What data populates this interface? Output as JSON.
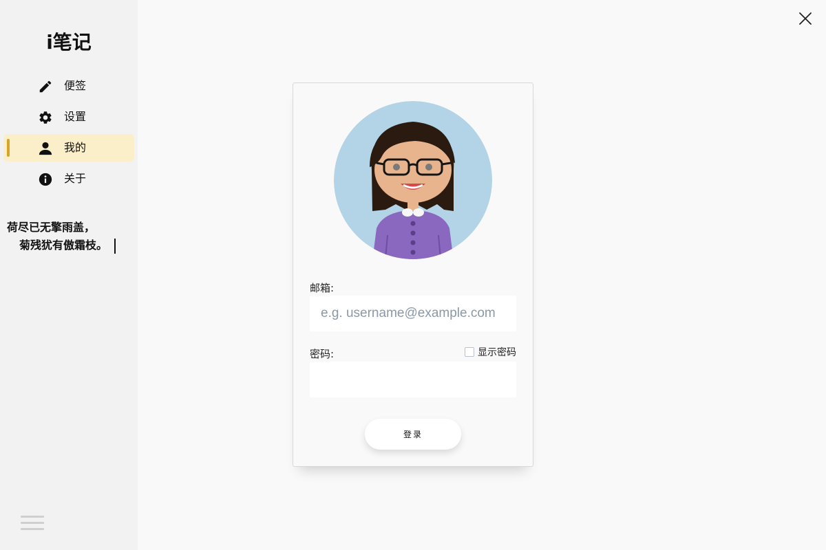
{
  "app": {
    "title": "i笔记"
  },
  "sidebar": {
    "items": [
      {
        "label": "便签",
        "icon": "pencil-icon",
        "active": false
      },
      {
        "label": "设置",
        "icon": "gear-icon",
        "active": false
      },
      {
        "label": "我的",
        "icon": "user-icon",
        "active": true
      },
      {
        "label": "关于",
        "icon": "info-icon",
        "active": false
      }
    ],
    "poem": {
      "line1": "荷尽已无擎雨盖，",
      "line2": "菊残犹有傲霜枝。"
    }
  },
  "login": {
    "email_label": "邮箱:",
    "email_placeholder": "e.g. username@example.com",
    "email_value": "",
    "password_label": "密码:",
    "password_value": "",
    "show_password_label": "显示密码",
    "show_password_checked": false,
    "submit_label": "登录"
  },
  "colors": {
    "active_bg": "#fbefc9",
    "active_accent": "#d6a62a",
    "sidebar_bg": "#f2f2f2",
    "avatar_bg": "#b3d4e6",
    "shirt": "#8a68c0"
  }
}
